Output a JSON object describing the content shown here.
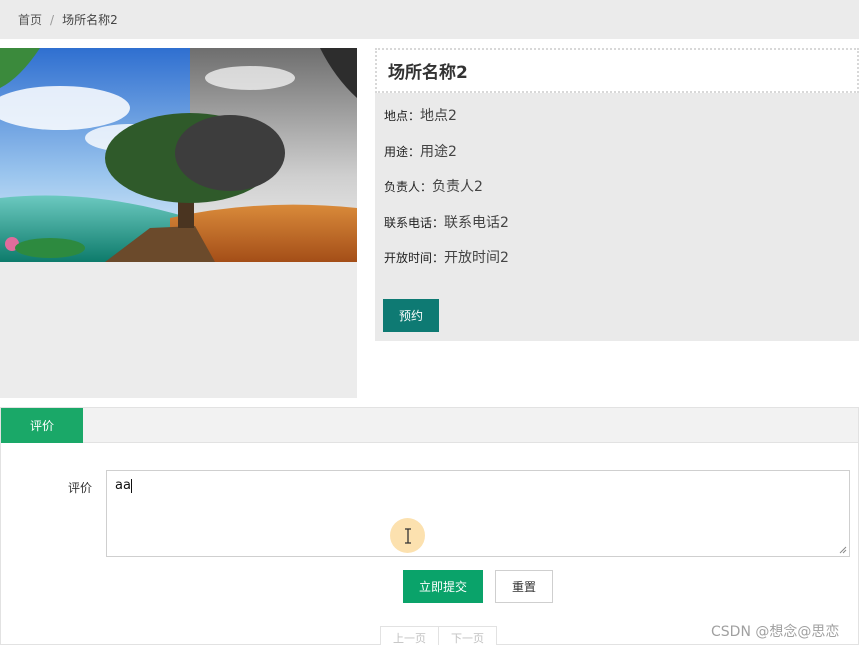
{
  "breadcrumb": {
    "home": "首页",
    "separator": "/",
    "current": "场所名称2"
  },
  "venue": {
    "title": "场所名称2",
    "fields": [
      {
        "label": "地点：",
        "value": "地点2"
      },
      {
        "label": "用途：",
        "value": "用途2"
      },
      {
        "label": "负责人：",
        "value": "负责人2"
      },
      {
        "label": "联系电话：",
        "value": "联系电话2"
      },
      {
        "label": "开放时间：",
        "value": "开放时间2"
      }
    ],
    "book_label": "预约"
  },
  "tabs": [
    {
      "label": "评价",
      "active": true
    }
  ],
  "review": {
    "label": "评价",
    "value": "aa",
    "submit_label": "立即提交",
    "reset_label": "重置"
  },
  "pager": {
    "prev": "上一页",
    "next": "下一页"
  },
  "watermark": "CSDN @想念@思恋",
  "colors": {
    "primary": "#0aa36a",
    "book": "#0e7a73",
    "tab_active": "#1aa868"
  },
  "icons": {
    "cursor": "text-cursor-icon",
    "resize": "resize-grip-icon"
  }
}
